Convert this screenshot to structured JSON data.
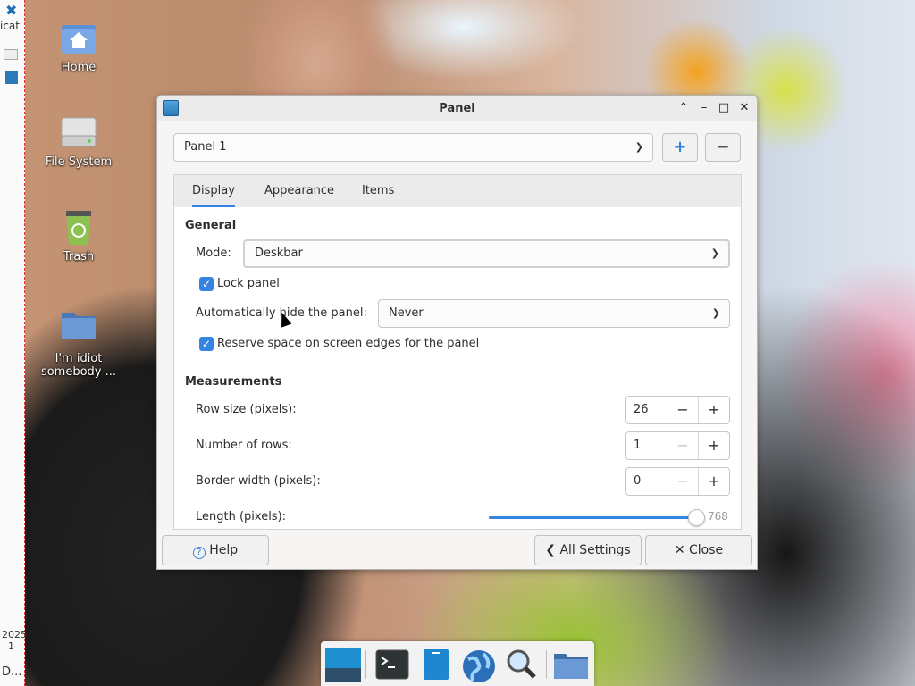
{
  "left_strip": {
    "top_text": "icat",
    "date_text": "2025",
    "date_sub": "1",
    "bottom_text": "D..."
  },
  "desktop_icons": [
    {
      "name": "desktop-home",
      "label": "Home",
      "icon": "home-folder-icon"
    },
    {
      "name": "desktop-filesystem",
      "label": "File System",
      "icon": "drive-icon"
    },
    {
      "name": "desktop-trash",
      "label": "Trash",
      "icon": "trash-icon"
    },
    {
      "name": "desktop-folder",
      "label": "I'm idiot somebody ...",
      "icon": "folder-icon"
    }
  ],
  "window": {
    "title": "Panel",
    "controls": {
      "shade": "⌃",
      "minimize": "–",
      "maximize": "□",
      "close": "✕"
    },
    "panel_select": "Panel 1",
    "add_label": "+",
    "remove_label": "−",
    "tabs": [
      "Display",
      "Appearance",
      "Items"
    ],
    "general": {
      "heading": "General",
      "mode_label": "Mode:",
      "mode_value": "Deskbar",
      "lock_label": "Lock panel",
      "lock_checked": true,
      "autohide_label": "Automatically hide the panel:",
      "autohide_value": "Never",
      "reserve_label": "Reserve space on screen edges for the panel",
      "reserve_checked": true
    },
    "measurements": {
      "heading": "Measurements",
      "row_size_label": "Row size (pixels):",
      "row_size_value": "26",
      "rows_label": "Number of rows:",
      "rows_value": "1",
      "border_label": "Border width (pixels):",
      "border_value": "0",
      "length_label": "Length (pixels):",
      "length_value": "768"
    },
    "footer": {
      "help": "Help",
      "all_settings": "All Settings",
      "close": "Close"
    }
  },
  "taskbar": [
    "show-desktop-icon",
    "terminal-icon",
    "file-manager-icon",
    "web-browser-icon",
    "search-icon",
    "folder-icon"
  ],
  "colors": {
    "accent": "#3584e4",
    "window_bg": "#f6f5f4"
  }
}
